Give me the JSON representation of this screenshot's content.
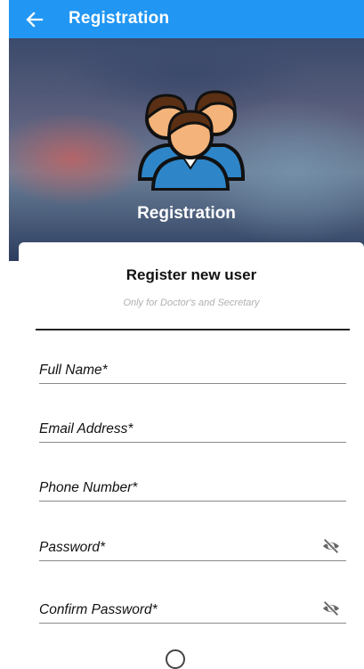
{
  "appbar": {
    "title": "Registration",
    "back_icon": "arrow-back-icon"
  },
  "hero": {
    "title": "Registration",
    "icon": "users-group-icon"
  },
  "card": {
    "title": "Register new user",
    "subtitle": "Only for Doctor's and Secretary"
  },
  "fields": [
    {
      "label": "Full Name*"
    },
    {
      "label": "Email Address*"
    },
    {
      "label": "Phone Number*"
    },
    {
      "label": "Password*",
      "icon": "visibility-off-icon"
    },
    {
      "label": "Confirm Password*",
      "icon": "visibility-off-icon"
    }
  ],
  "colors": {
    "primary": "#2196f3",
    "text": "#111111",
    "hint": "#b0b0b0"
  }
}
